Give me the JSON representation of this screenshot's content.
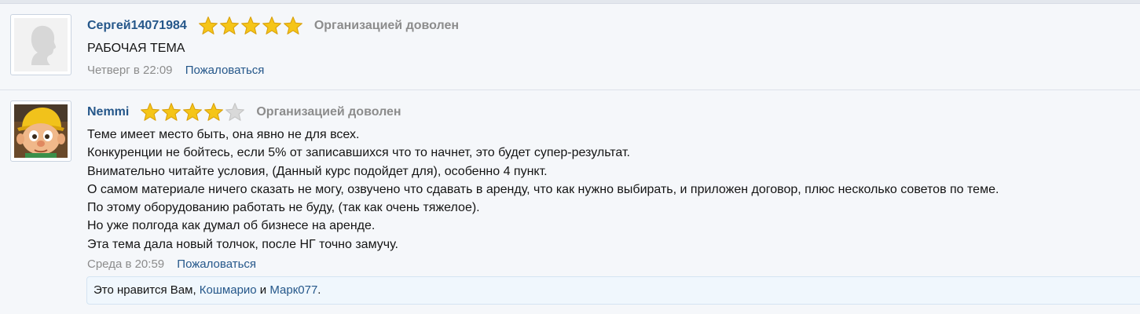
{
  "reviews": [
    {
      "username": "Сергей14071984",
      "rating": 5,
      "max_rating": 5,
      "verdict": "Организацией доволен",
      "avatar_icon": "default-user-silhouette-icon",
      "lines": [
        "РАБОЧАЯ ТЕМА"
      ],
      "date": "Четверг в 22:09",
      "report_label": "Пожаловаться"
    },
    {
      "username": "Nemmi",
      "rating": 4,
      "max_rating": 5,
      "verdict": "Организацией доволен",
      "avatar_icon": "cartoon-character-avatar-icon",
      "lines": [
        "Теме имеет место быть, она явно не для всех.",
        "Конкуренции не бойтесь, если 5% от записавшихся что то начнет, это будет супер-результат.",
        "Внимательно читайте условия, (Данный курс подойдет для), особенно 4 пункт.",
        "О самом материале ничего сказать не могу, озвучено что сдавать в аренду, что как нужно выбирать, и приложен договор, плюс несколько советов по теме.",
        "По этому оборудованию работать не буду, (так как очень тяжелое).",
        "Но уже полгода как думал об бизнесе на аренде.",
        "Эта тема дала новый толчок, после НГ точно замучу."
      ],
      "date": "Среда в 20:59",
      "report_label": "Пожаловаться",
      "likes": {
        "prefix": "Это нравится Вам, ",
        "user1": "Кошмарио",
        "conjunction": " и ",
        "user2": "Марк077",
        "suffix": "."
      }
    }
  ],
  "colors": {
    "link": "#25578a",
    "muted": "#8c8c8c",
    "star_filled": "#f5c518",
    "star_empty": "#d9d9d9",
    "likes_background": "#f0f7fd"
  }
}
